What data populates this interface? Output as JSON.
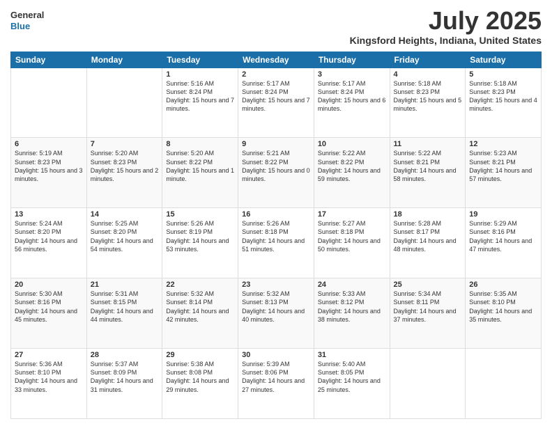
{
  "logo": {
    "general": "General",
    "blue": "Blue"
  },
  "title": "July 2025",
  "subtitle": "Kingsford Heights, Indiana, United States",
  "days_of_week": [
    "Sunday",
    "Monday",
    "Tuesday",
    "Wednesday",
    "Thursday",
    "Friday",
    "Saturday"
  ],
  "weeks": [
    [
      {
        "day": "",
        "info": ""
      },
      {
        "day": "",
        "info": ""
      },
      {
        "day": "1",
        "info": "Sunrise: 5:16 AM\nSunset: 8:24 PM\nDaylight: 15 hours and 7 minutes."
      },
      {
        "day": "2",
        "info": "Sunrise: 5:17 AM\nSunset: 8:24 PM\nDaylight: 15 hours and 7 minutes."
      },
      {
        "day": "3",
        "info": "Sunrise: 5:17 AM\nSunset: 8:24 PM\nDaylight: 15 hours and 6 minutes."
      },
      {
        "day": "4",
        "info": "Sunrise: 5:18 AM\nSunset: 8:23 PM\nDaylight: 15 hours and 5 minutes."
      },
      {
        "day": "5",
        "info": "Sunrise: 5:18 AM\nSunset: 8:23 PM\nDaylight: 15 hours and 4 minutes."
      }
    ],
    [
      {
        "day": "6",
        "info": "Sunrise: 5:19 AM\nSunset: 8:23 PM\nDaylight: 15 hours and 3 minutes."
      },
      {
        "day": "7",
        "info": "Sunrise: 5:20 AM\nSunset: 8:23 PM\nDaylight: 15 hours and 2 minutes."
      },
      {
        "day": "8",
        "info": "Sunrise: 5:20 AM\nSunset: 8:22 PM\nDaylight: 15 hours and 1 minute."
      },
      {
        "day": "9",
        "info": "Sunrise: 5:21 AM\nSunset: 8:22 PM\nDaylight: 15 hours and 0 minutes."
      },
      {
        "day": "10",
        "info": "Sunrise: 5:22 AM\nSunset: 8:22 PM\nDaylight: 14 hours and 59 minutes."
      },
      {
        "day": "11",
        "info": "Sunrise: 5:22 AM\nSunset: 8:21 PM\nDaylight: 14 hours and 58 minutes."
      },
      {
        "day": "12",
        "info": "Sunrise: 5:23 AM\nSunset: 8:21 PM\nDaylight: 14 hours and 57 minutes."
      }
    ],
    [
      {
        "day": "13",
        "info": "Sunrise: 5:24 AM\nSunset: 8:20 PM\nDaylight: 14 hours and 56 minutes."
      },
      {
        "day": "14",
        "info": "Sunrise: 5:25 AM\nSunset: 8:20 PM\nDaylight: 14 hours and 54 minutes."
      },
      {
        "day": "15",
        "info": "Sunrise: 5:26 AM\nSunset: 8:19 PM\nDaylight: 14 hours and 53 minutes."
      },
      {
        "day": "16",
        "info": "Sunrise: 5:26 AM\nSunset: 8:18 PM\nDaylight: 14 hours and 51 minutes."
      },
      {
        "day": "17",
        "info": "Sunrise: 5:27 AM\nSunset: 8:18 PM\nDaylight: 14 hours and 50 minutes."
      },
      {
        "day": "18",
        "info": "Sunrise: 5:28 AM\nSunset: 8:17 PM\nDaylight: 14 hours and 48 minutes."
      },
      {
        "day": "19",
        "info": "Sunrise: 5:29 AM\nSunset: 8:16 PM\nDaylight: 14 hours and 47 minutes."
      }
    ],
    [
      {
        "day": "20",
        "info": "Sunrise: 5:30 AM\nSunset: 8:16 PM\nDaylight: 14 hours and 45 minutes."
      },
      {
        "day": "21",
        "info": "Sunrise: 5:31 AM\nSunset: 8:15 PM\nDaylight: 14 hours and 44 minutes."
      },
      {
        "day": "22",
        "info": "Sunrise: 5:32 AM\nSunset: 8:14 PM\nDaylight: 14 hours and 42 minutes."
      },
      {
        "day": "23",
        "info": "Sunrise: 5:32 AM\nSunset: 8:13 PM\nDaylight: 14 hours and 40 minutes."
      },
      {
        "day": "24",
        "info": "Sunrise: 5:33 AM\nSunset: 8:12 PM\nDaylight: 14 hours and 38 minutes."
      },
      {
        "day": "25",
        "info": "Sunrise: 5:34 AM\nSunset: 8:11 PM\nDaylight: 14 hours and 37 minutes."
      },
      {
        "day": "26",
        "info": "Sunrise: 5:35 AM\nSunset: 8:10 PM\nDaylight: 14 hours and 35 minutes."
      }
    ],
    [
      {
        "day": "27",
        "info": "Sunrise: 5:36 AM\nSunset: 8:10 PM\nDaylight: 14 hours and 33 minutes."
      },
      {
        "day": "28",
        "info": "Sunrise: 5:37 AM\nSunset: 8:09 PM\nDaylight: 14 hours and 31 minutes."
      },
      {
        "day": "29",
        "info": "Sunrise: 5:38 AM\nSunset: 8:08 PM\nDaylight: 14 hours and 29 minutes."
      },
      {
        "day": "30",
        "info": "Sunrise: 5:39 AM\nSunset: 8:06 PM\nDaylight: 14 hours and 27 minutes."
      },
      {
        "day": "31",
        "info": "Sunrise: 5:40 AM\nSunset: 8:05 PM\nDaylight: 14 hours and 25 minutes."
      },
      {
        "day": "",
        "info": ""
      },
      {
        "day": "",
        "info": ""
      }
    ]
  ]
}
